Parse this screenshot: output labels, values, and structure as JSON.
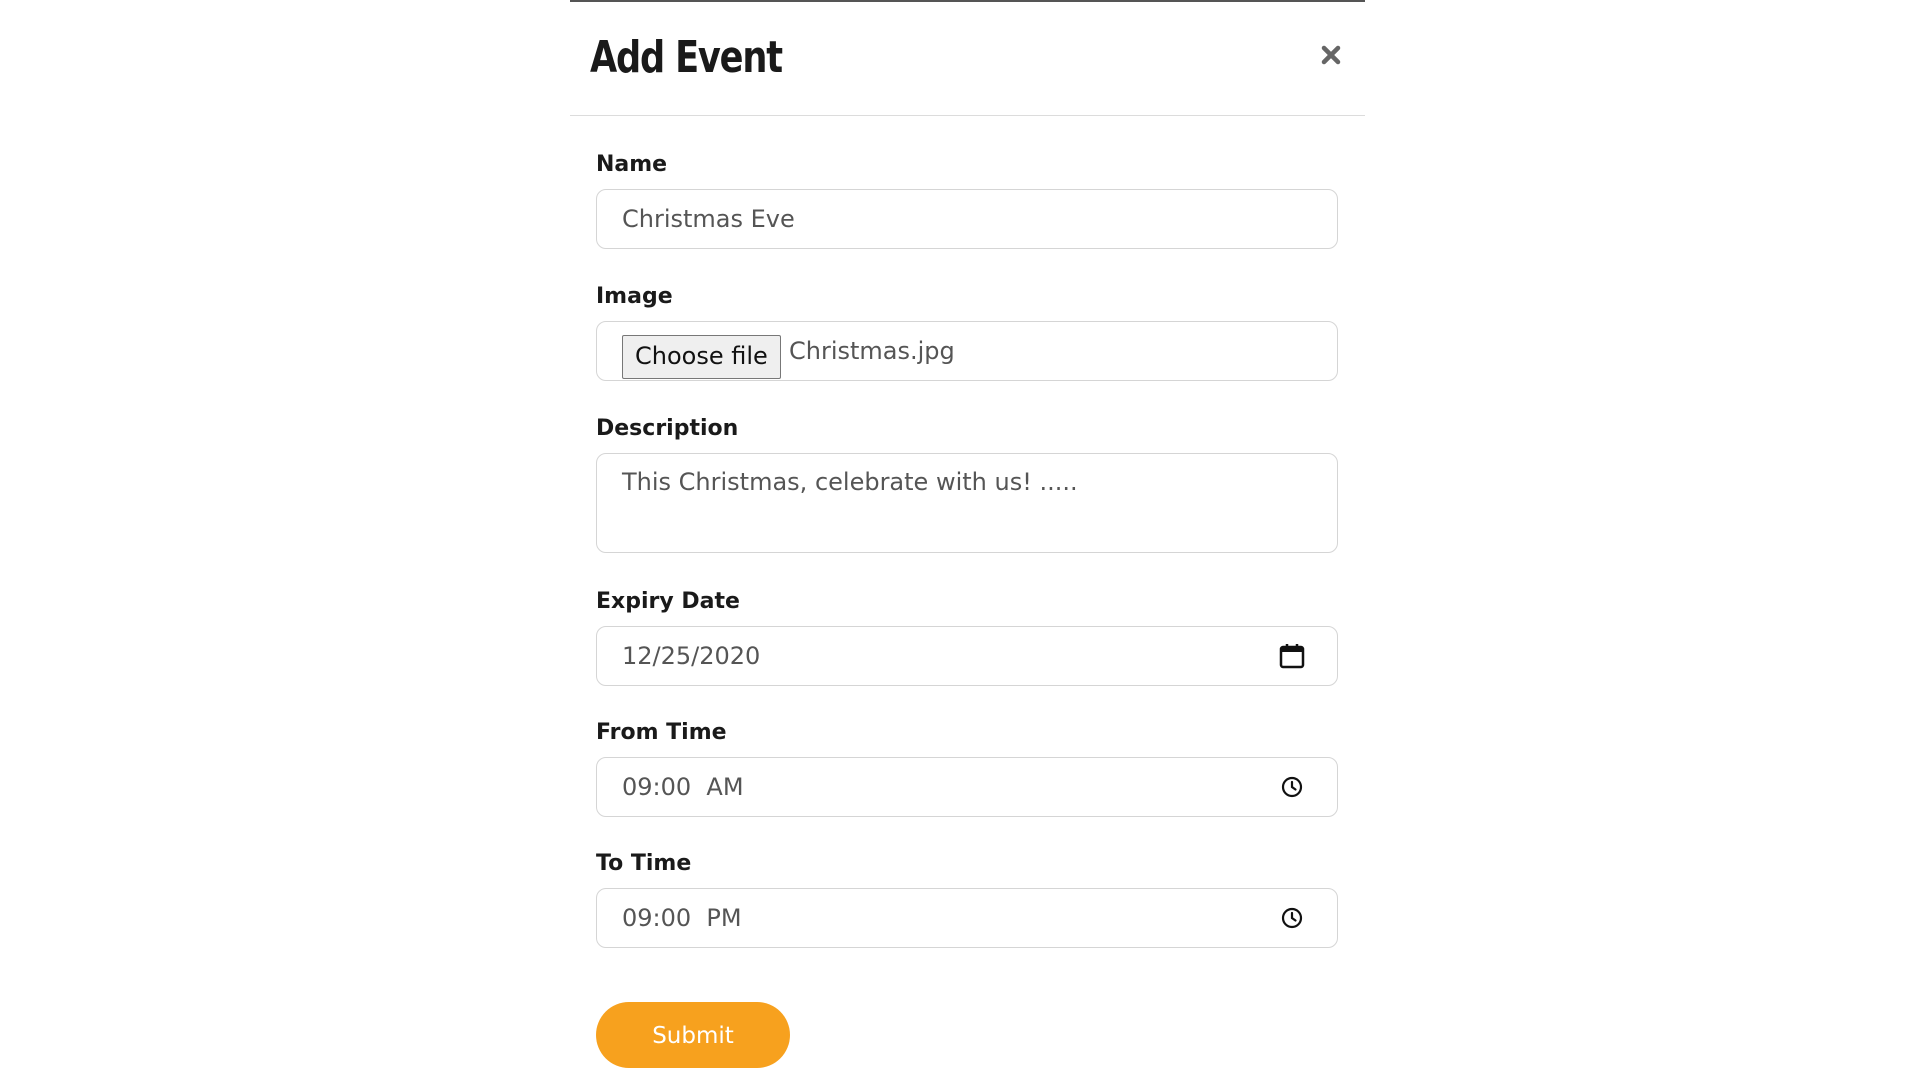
{
  "modal": {
    "title": "Add Event",
    "close_icon": "close-x-icon"
  },
  "form": {
    "name": {
      "label": "Name",
      "value": "Christmas Eve"
    },
    "image": {
      "label": "Image",
      "choose_button": "Choose file",
      "file_name": "Christmas.jpg"
    },
    "description": {
      "label": "Description",
      "value": "This Christmas, celebrate with us! ....."
    },
    "expiry_date": {
      "label": "Expiry Date",
      "value": "12/25/2020",
      "icon": "calendar-icon"
    },
    "from_time": {
      "label": "From Time",
      "value": "09:00  AM",
      "icon": "clock-icon"
    },
    "to_time": {
      "label": "To Time",
      "value": "09:00  PM",
      "icon": "clock-icon"
    },
    "submit_label": "Submit"
  },
  "colors": {
    "accent": "#f7a11e",
    "border": "#d5d5d5",
    "text": "#555555"
  }
}
